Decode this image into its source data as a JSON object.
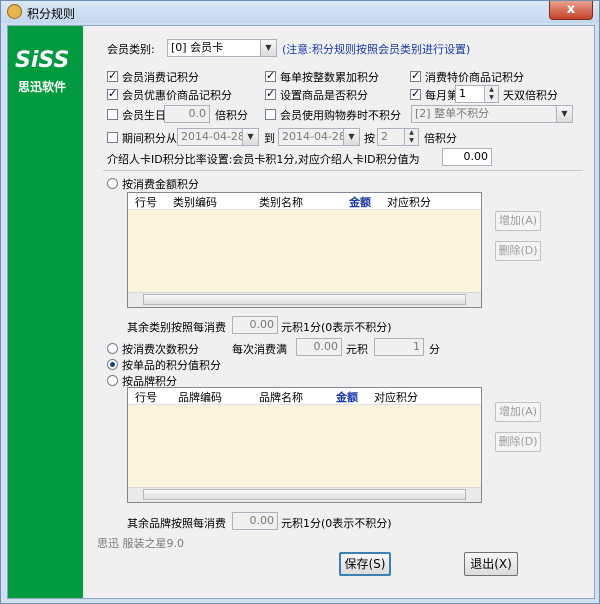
{
  "window": {
    "title": "积分规则",
    "close_symbol": "x"
  },
  "sidebar": {
    "logo": "SiSS",
    "subtitle": "思迅软件"
  },
  "member_type": {
    "label": "会员类别:",
    "value": "[0] 会员卡",
    "note": "(注意:积分规则按照会员类别进行设置)"
  },
  "options": {
    "member_points": "会员消费记积分",
    "per_order_accumulate": "每单按整数累加积分",
    "special_price_points": "消费特价商品记积分",
    "discount_points": "会员优惠价商品记积分",
    "set_item_points": "设置商品是否积分",
    "monthly": "每月第",
    "monthly_day": "1",
    "monthly_suffix": "天双倍积分",
    "birthday": "会员生日",
    "birthday_multiplier": "0.0",
    "birthday_suffix": "倍积分",
    "shopping_card": "会员使用购物券时不积分",
    "shopping_card_mode": "[2] 整单不积分",
    "period": "期间积分从",
    "period_from": "2014-04-28",
    "period_to_label": "到",
    "period_to": "2014-04-28",
    "period_by": "按",
    "period_multiplier": "2",
    "period_suffix": "倍积分",
    "intro_text": "介绍人卡ID积分比率设置:会员卡积1分,对应介绍人卡ID积分值为",
    "intro_value": "0.00"
  },
  "section_amount": {
    "radio_label": "按消费金额积分",
    "columns": [
      "行号",
      "类别编码",
      "类别名称",
      "金额",
      "对应积分"
    ],
    "add_label": "增加(A)",
    "delete_label": "删除(D)",
    "other_label": "其余类别按照每消费",
    "other_value": "0.00",
    "other_suffix": "元积1分(0表示不积分)"
  },
  "section_count": {
    "radio_label": "按消费次数积分",
    "each_label": "每次消费满",
    "each_value": "0.00",
    "yuan_label": "元积",
    "points_value": "1",
    "points_suffix": "分"
  },
  "section_item": {
    "radio_label": "按单品的积分值积分"
  },
  "section_brand": {
    "radio_label": "按品牌积分",
    "columns": [
      "行号",
      "品牌编码",
      "品牌名称",
      "金额",
      "对应积分"
    ],
    "add_label": "增加(A)",
    "delete_label": "删除(D)",
    "other_label": "其余品牌按照每消费",
    "other_value": "0.00",
    "other_suffix": "元积1分(0表示不积分)"
  },
  "footer": {
    "version": "思迅 服装之星9.0",
    "save_label": "保存(S)",
    "exit_label": "退出(X)"
  }
}
